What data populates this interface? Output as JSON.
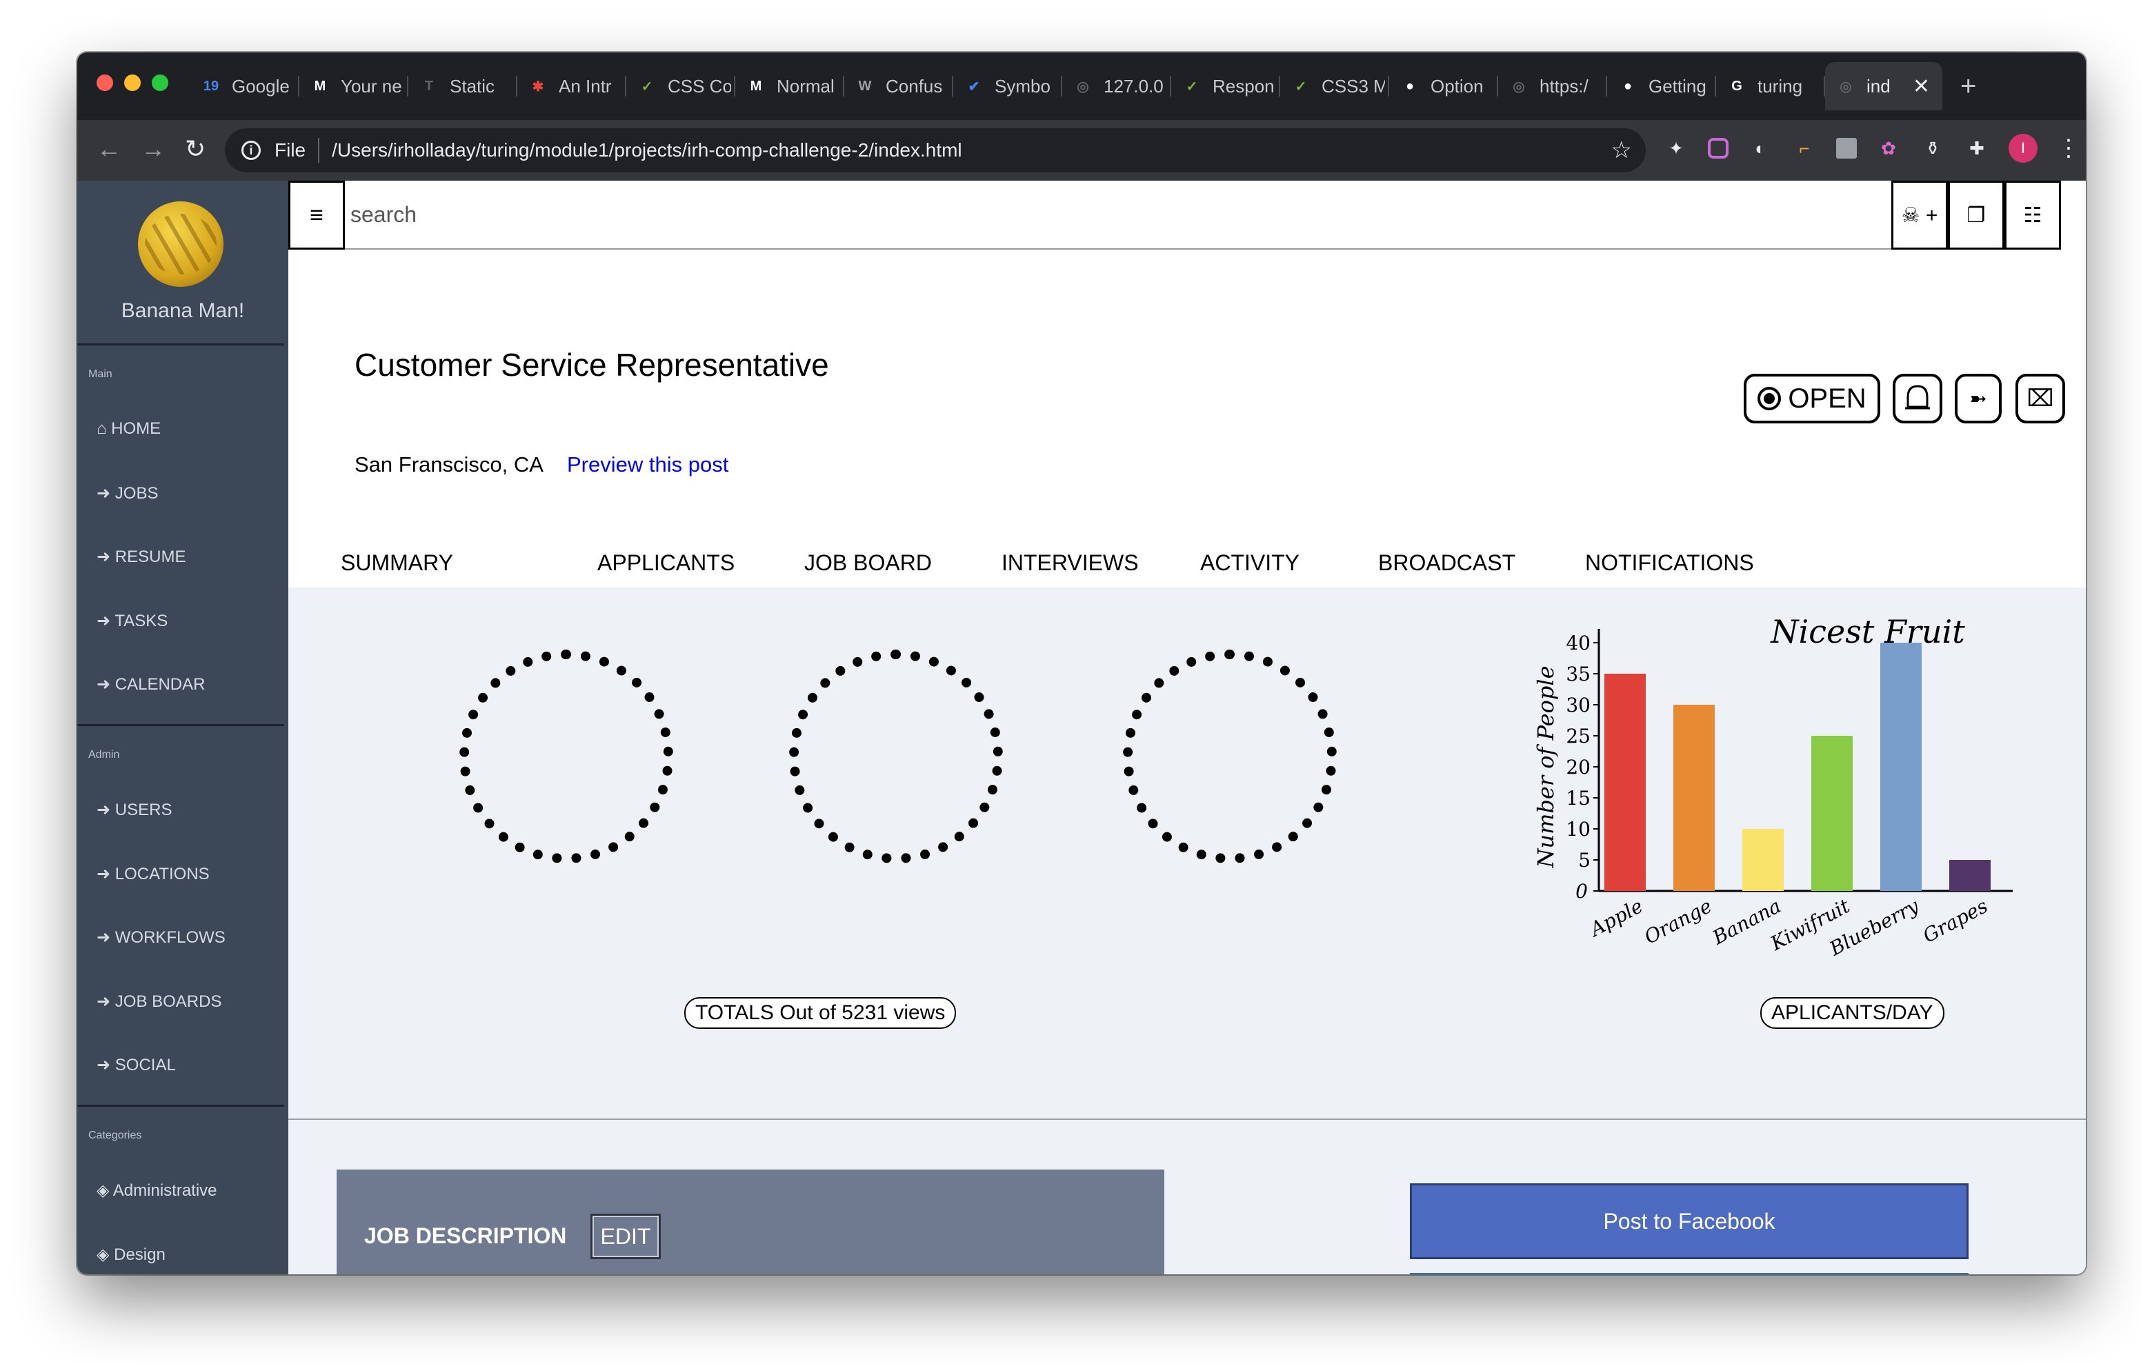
{
  "browser": {
    "tabs": [
      {
        "title": "Google",
        "icon": "calendar-icon",
        "color": "#4285f4",
        "glyph": "19"
      },
      {
        "title": "Your ne",
        "icon": "gmail-icon",
        "color": "#ffffff",
        "glyph": "M"
      },
      {
        "title": "Static",
        "icon": "page-icon",
        "color": "#5f6368",
        "glyph": "T"
      },
      {
        "title": "An Intr",
        "icon": "asterisk-icon",
        "color": "#e8453c",
        "glyph": "✱"
      },
      {
        "title": "CSS Co",
        "icon": "css-icon",
        "color": "#7cb342",
        "glyph": "✓"
      },
      {
        "title": "Normal",
        "icon": "medium-icon",
        "color": "#ffffff",
        "glyph": "M"
      },
      {
        "title": "Confus",
        "icon": "wordpress-icon",
        "color": "#9aa0a6",
        "glyph": "W"
      },
      {
        "title": "Symbo",
        "icon": "check-icon",
        "color": "#4285f4",
        "glyph": "✔"
      },
      {
        "title": "127.0.0",
        "icon": "globe-icon",
        "color": "#5f6368",
        "glyph": "◎"
      },
      {
        "title": "Respon",
        "icon": "css-icon",
        "color": "#7cb342",
        "glyph": "✓"
      },
      {
        "title": "CSS3 M",
        "icon": "css-icon",
        "color": "#7cb342",
        "glyph": "✓"
      },
      {
        "title": "Option",
        "icon": "github-icon",
        "color": "#ffffff",
        "glyph": "●"
      },
      {
        "title": "https:/",
        "icon": "globe-icon",
        "color": "#5f6368",
        "glyph": "◎"
      },
      {
        "title": "Getting",
        "icon": "github-icon",
        "color": "#ffffff",
        "glyph": "●"
      },
      {
        "title": "turing",
        "icon": "google-icon",
        "color": "#ffffff",
        "glyph": "G"
      },
      {
        "title": "ind",
        "icon": "globe-icon",
        "color": "#5f6368",
        "glyph": "◎",
        "active": true
      }
    ],
    "new_tab": "+",
    "close_tab": "✕",
    "scheme": "File",
    "url": "/Users/irholladay/turing/module1/projects/irh-comp-challenge-2/index.html",
    "profile_initial": "I"
  },
  "sidebar": {
    "user_name": "Banana Man!",
    "sections": [
      {
        "heading": "Main",
        "items": [
          "⌂ HOME",
          "➜ JOBS",
          "➜ RESUME",
          "➜ TASKS",
          "➜ CALENDAR"
        ]
      },
      {
        "heading": "Admin",
        "items": [
          "➜ USERS",
          "➜ LOCATIONS",
          "➜ WORKFLOWS",
          "➜ JOB BOARDS",
          "➜ SOCIAL"
        ]
      },
      {
        "heading": "Categories",
        "items": [
          "◈ Administrative",
          "◈ Design"
        ]
      }
    ]
  },
  "topbar": {
    "menu_icon": "≡",
    "search_placeholder": "search",
    "add_user_label": "☠ +",
    "window_label": "❐",
    "grid_label": "☷"
  },
  "job": {
    "title": "Customer Service Representative",
    "location": "San Franscisco, CA",
    "preview_link": "Preview this post",
    "status": "OPEN",
    "bell": "🔔",
    "share": "➼",
    "close": "⌧"
  },
  "tabs": [
    "SUMMARY",
    "APPLICANTS",
    "JOB BOARD",
    "INTERVIEWS",
    "ACTIVITY",
    "BROADCAST",
    "NOTIFICATIONS"
  ],
  "stats": {
    "totals_label": "TOTALS Out of 5231 views",
    "applicants_label": "APLICANTS/DAY"
  },
  "chart_data": {
    "type": "bar",
    "title": "Nicest Fruit",
    "ylabel": "Number of People",
    "xlabel": "",
    "categories": [
      "Apple",
      "Orange",
      "Banana",
      "Kiwifruit",
      "Blueberry",
      "Grapes"
    ],
    "values": [
      35,
      30,
      10,
      25,
      40,
      5
    ],
    "colors": [
      "#e0403a",
      "#e88a33",
      "#fae36a",
      "#8acb45",
      "#7a9ecb",
      "#52366a"
    ],
    "ylim": [
      0,
      40
    ],
    "yticks": [
      0,
      5,
      10,
      15,
      20,
      25,
      30,
      35,
      40
    ],
    "grid": false
  },
  "bottom": {
    "job_description": "JOB DESCRIPTION",
    "edit": "EDIT",
    "post_facebook": "Post to Facebook"
  }
}
